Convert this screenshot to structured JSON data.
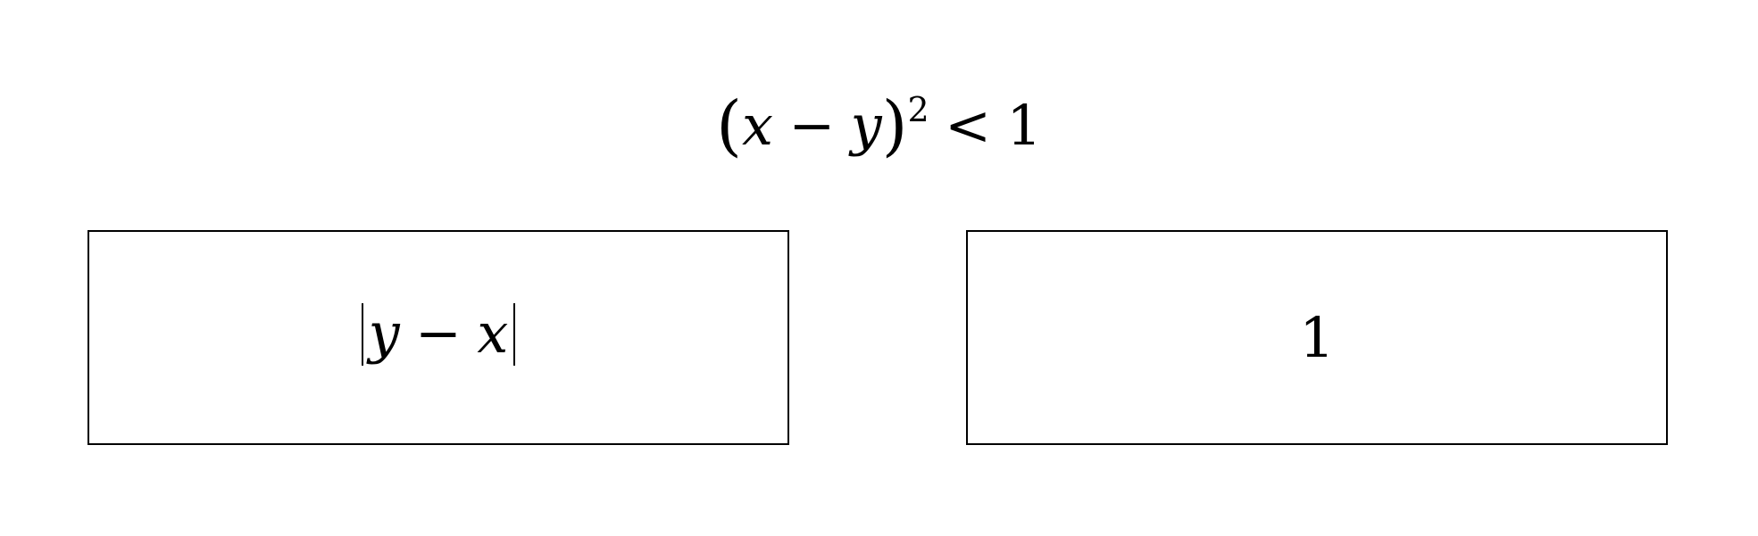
{
  "header": {
    "paren_open": "(",
    "var_x": "x",
    "minus": "−",
    "var_y": "y",
    "paren_close": ")",
    "exponent": "2",
    "relation": "<",
    "rhs": "1"
  },
  "boxes": {
    "left": {
      "var_y": "y",
      "minus": "−",
      "var_x": "x"
    },
    "right": {
      "value": "1"
    }
  }
}
